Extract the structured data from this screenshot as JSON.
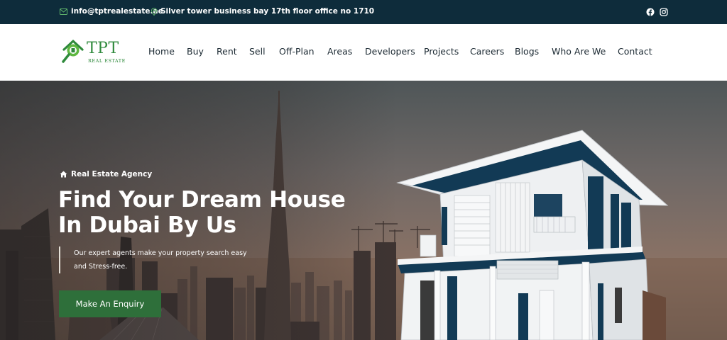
{
  "topbar": {
    "email": "info@tptrealestate.ae",
    "address": "Silver tower business bay 17th floor office no 1710",
    "social": [
      "facebook-icon",
      "instagram-icon"
    ]
  },
  "logo": {
    "name": "TPT",
    "sub": "REAL ESTATE"
  },
  "nav": {
    "items": [
      "Home",
      "Buy",
      "Rent",
      "Sell",
      "Off-Plan",
      "Areas",
      "Developers",
      "Projects",
      "Careers",
      "Blogs",
      "Who Are We",
      "Contact"
    ]
  },
  "hero": {
    "tag": "Real Estate Agency",
    "title_line1": "Find Your Dream House",
    "title_line2": "In Dubai By Us",
    "desc_line1": "Our expert agents make your property search easy",
    "desc_line2": "and Stress-free.",
    "cta": "Make An Enquiry"
  },
  "colors": {
    "topbar": "#0e2c3b",
    "brand_green": "#2f8a3c",
    "cta": "#2e6f3a",
    "house_accent": "#123a55"
  }
}
